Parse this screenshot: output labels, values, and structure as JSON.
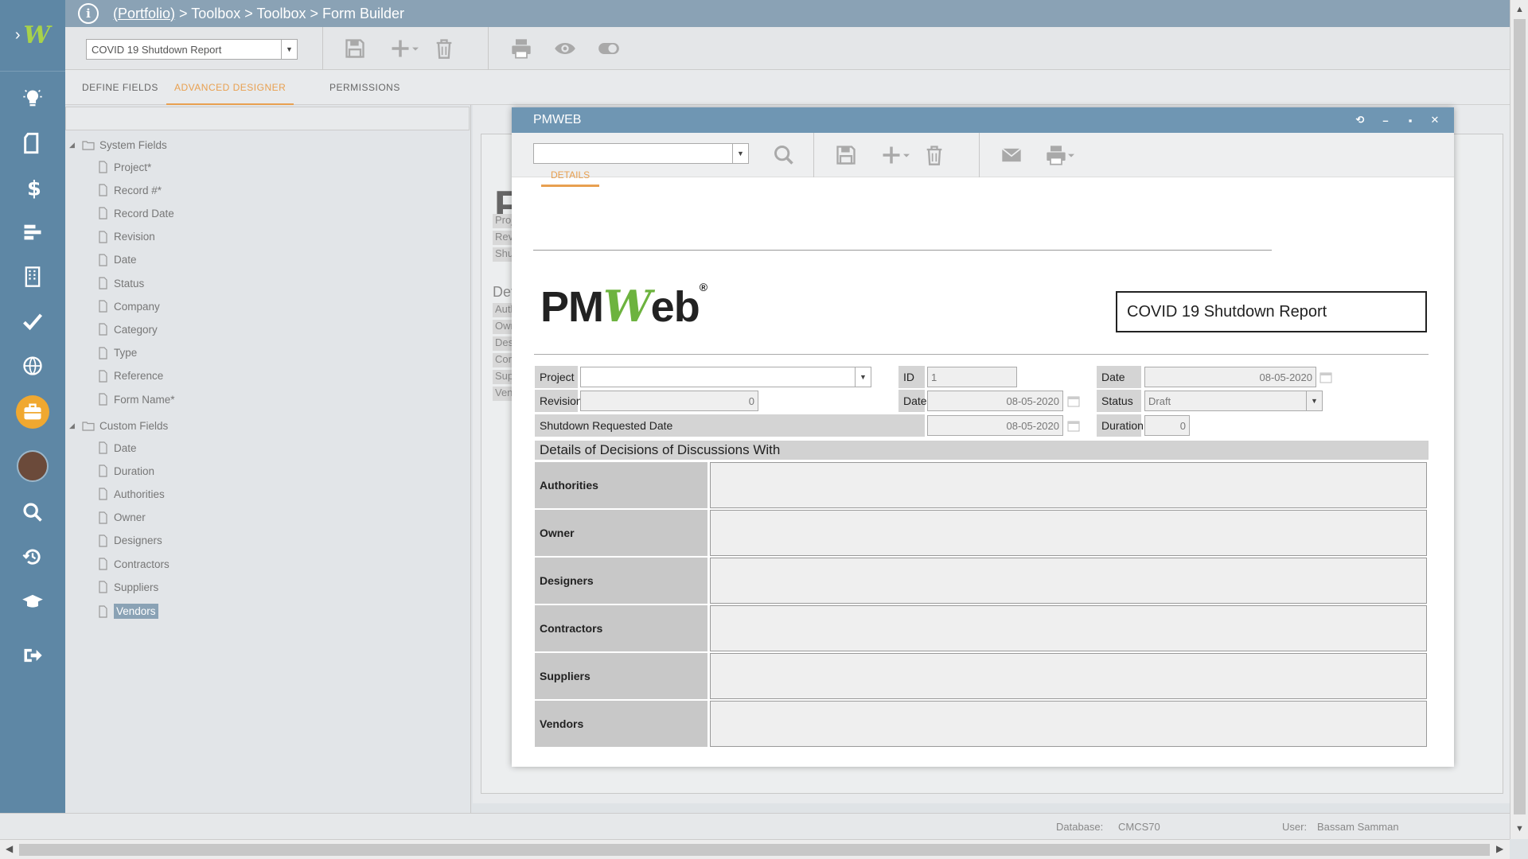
{
  "breadcrumb": {
    "link": "(Portfolio)",
    "rest": " > Toolbox > Toolbox > Form Builder"
  },
  "toolbar": {
    "form_select": "COVID 19 Shutdown Report"
  },
  "tabs": [
    {
      "label": "DEFINE FIELDS"
    },
    {
      "label": "ADVANCED DESIGNER"
    },
    {
      "label": "PERMISSIONS"
    }
  ],
  "tree": {
    "system_folder": "System Fields",
    "system_fields": [
      "Project*",
      "Record #*",
      "Record Date",
      "Revision",
      "Date",
      "Status",
      "Company",
      "Category",
      "Type",
      "Reference",
      "Form Name*"
    ],
    "custom_folder": "Custom Fields",
    "custom_fields": [
      "Date",
      "Duration",
      "Authorities",
      "Owner",
      "Designers",
      "Contractors",
      "Suppliers",
      "Vendors"
    ]
  },
  "designer_ghost": {
    "big": "F",
    "labels": [
      "Proj",
      "Revi",
      "Shu"
    ],
    "details": "Det",
    "labels2": [
      "Auth",
      "Own",
      "Des",
      "Con",
      "Sup",
      "Ven"
    ]
  },
  "modal": {
    "title": "PMWEB",
    "tab": "DETAILS",
    "logo": {
      "pm": "PM",
      "w": "W",
      "eb": "eb",
      "reg": "®"
    },
    "form_title": "COVID 19 Shutdown Report",
    "fields": {
      "project_label": "Project",
      "id_label": "ID",
      "id_value": "1",
      "date_label": "Date",
      "date_value": "08-05-2020",
      "revision_label": "Revision",
      "revision_value": "0",
      "date2_label": "Date",
      "date2_value": "08-05-2020",
      "status_label": "Status",
      "status_value": "Draft",
      "shutdown_label": "Shutdown Requested Date",
      "shutdown_value": "08-05-2020",
      "duration_label": "Duration",
      "duration_value": "0"
    },
    "section_title": "Details of Decisions of Discussions With",
    "detail_rows": [
      "Authorities",
      "Owner",
      "Designers",
      "Contractors",
      "Suppliers",
      "Vendors"
    ]
  },
  "status": {
    "db_label": "Database:",
    "db_value": "CMCS70",
    "user_label": "User:",
    "user_value": "Bassam Samman"
  },
  "colors": {
    "rail": "#5e87a5",
    "accent": "#e8a050",
    "modal_title": "#6f96b3",
    "logo_green": "#6db33f"
  }
}
